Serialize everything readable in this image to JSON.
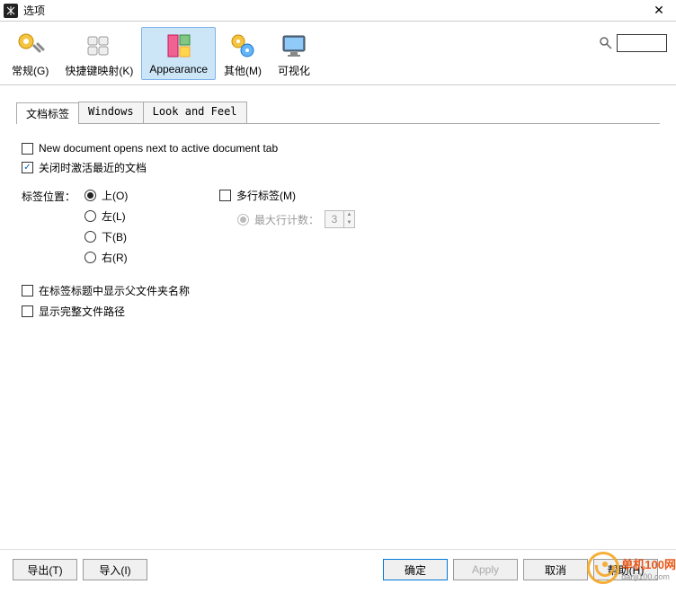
{
  "window": {
    "title": "选项"
  },
  "toolbar": {
    "items": [
      {
        "label": "常规(G)"
      },
      {
        "label": "快捷键映射(K)"
      },
      {
        "label": "Appearance"
      },
      {
        "label": "其他(M)"
      },
      {
        "label": "可视化"
      }
    ],
    "selected_index": 2
  },
  "search": {
    "value": ""
  },
  "tabs": {
    "items": [
      {
        "label": "文档标签"
      },
      {
        "label": "Windows"
      },
      {
        "label": "Look and Feel"
      }
    ],
    "active_index": 0
  },
  "panel": {
    "chk_new_doc_next": {
      "label": "New document opens next to active document tab",
      "checked": false
    },
    "chk_activate_recent": {
      "label": "关闭时激活最近的文档",
      "checked": true
    },
    "tab_position": {
      "label": "标签位置：",
      "options": [
        {
          "label": "上(O)",
          "value": "top",
          "checked": true
        },
        {
          "label": "左(L)",
          "value": "left",
          "checked": false
        },
        {
          "label": "下(B)",
          "value": "bottom",
          "checked": false
        },
        {
          "label": "右(R)",
          "value": "right",
          "checked": false
        }
      ]
    },
    "chk_multirow": {
      "label": "多行标签(M)",
      "checked": false
    },
    "max_rows": {
      "label": "最大行计数：",
      "value": "3"
    },
    "chk_show_parent": {
      "label": "在标签标题中显示父文件夹名称",
      "checked": false
    },
    "chk_show_fullpath": {
      "label": "显示完整文件路径",
      "checked": false
    }
  },
  "footer": {
    "export": "导出(T)",
    "import": "导入(I)",
    "ok": "确定",
    "apply": "Apply",
    "cancel": "取消",
    "help": "帮助(H)"
  },
  "watermark": {
    "line1": "单机100网",
    "line2": "danji100.com"
  }
}
